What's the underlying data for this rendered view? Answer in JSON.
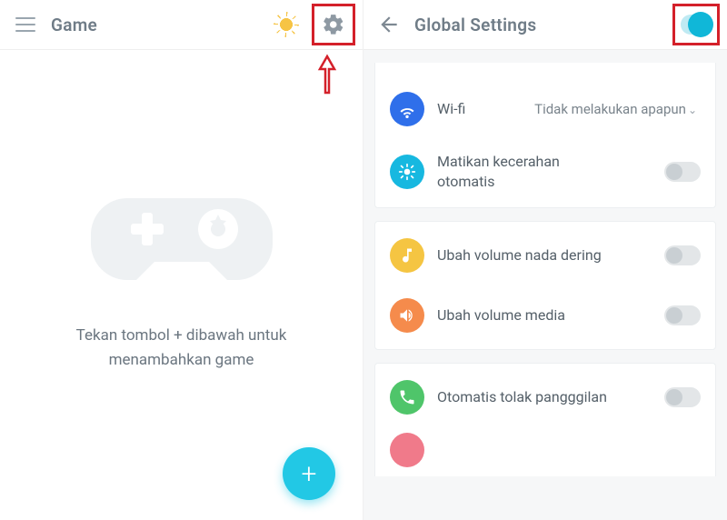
{
  "left": {
    "title": "Game",
    "empty_text": "Tekan tombol + dibawah untuk menambahkan game",
    "fab_label": "+"
  },
  "right": {
    "title": "Global Settings",
    "master_toggle_on": true,
    "groups": [
      {
        "id": "network",
        "items": [
          {
            "icon": "wifi",
            "color": "c-blue",
            "label": "Wi-fi",
            "value": "Tidak melakukan apapun",
            "control": "dropdown"
          },
          {
            "icon": "brightness",
            "color": "c-cyan",
            "label": "Matikan kecerahan otomatis",
            "control": "toggle",
            "on": false
          }
        ]
      },
      {
        "id": "volume",
        "items": [
          {
            "icon": "music",
            "color": "c-yellow",
            "label": "Ubah volume nada dering",
            "control": "toggle",
            "on": false
          },
          {
            "icon": "sound",
            "color": "c-orange",
            "label": "Ubah volume media",
            "control": "toggle",
            "on": false
          }
        ]
      },
      {
        "id": "calls",
        "items": [
          {
            "icon": "phone",
            "color": "c-green",
            "label": "Otomatis tolak pangggilan",
            "control": "toggle",
            "on": false
          }
        ]
      }
    ]
  }
}
